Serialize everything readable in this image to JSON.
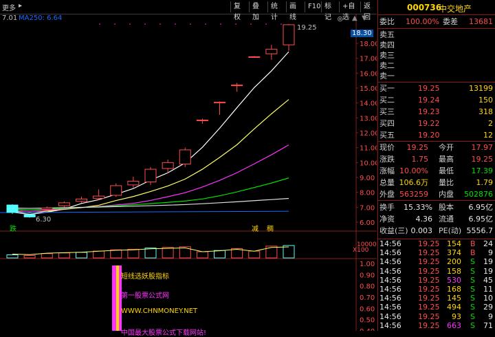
{
  "toolbar": {
    "more_label": "更多",
    "buttons": [
      "复权",
      "叠加",
      "统计",
      "画线",
      "F10",
      "标记",
      "+自选",
      "返回"
    ]
  },
  "chart_info": {
    "top_left_price": "7.01",
    "ma_label": "MA250: 6.64",
    "high_label": "19.25",
    "low_label": "6.30",
    "price_tag": "18.30",
    "marker_die": "跌",
    "marker_jian": "减",
    "marker_chou": "稠",
    "volume_unit": "X100",
    "volume_axis": "10000",
    "indicator_texts": [
      "短线选妖股指标",
      "第一股票公式网",
      "WWW.CHNMONEY.NET",
      "中国最大股票公式下载网站!"
    ]
  },
  "price_axis": [
    "18.00",
    "17.00",
    "16.00",
    "15.00",
    "14.00",
    "13.00",
    "12.00",
    "11.00",
    "10.00",
    "9.00",
    "8.00",
    "7.00",
    "6.00"
  ],
  "indicator_axis": [
    "1.00",
    "0.90",
    "0.80",
    "0.70",
    "0.60",
    "0.50",
    "0.40"
  ],
  "candles": [
    {
      "o": 7.15,
      "c": 6.65,
      "h": 7.2,
      "l": 6.55
    },
    {
      "o": 6.5,
      "c": 6.35,
      "h": 6.55,
      "l": 6.3
    },
    {
      "o": 6.85,
      "c": 6.95,
      "h": 7.05,
      "l": 6.8
    },
    {
      "o": 7.1,
      "c": 7.3,
      "h": 7.4,
      "l": 7.0
    },
    {
      "o": 7.4,
      "c": 7.55,
      "h": 7.7,
      "l": 7.3
    },
    {
      "o": 7.6,
      "c": 7.75,
      "h": 8.2,
      "l": 7.5
    },
    {
      "o": 7.8,
      "c": 8.45,
      "h": 8.6,
      "l": 7.7
    },
    {
      "o": 8.5,
      "c": 8.75,
      "h": 9.05,
      "l": 8.3
    },
    {
      "o": 8.7,
      "c": 9.55,
      "h": 9.7,
      "l": 8.5
    },
    {
      "o": 9.6,
      "c": 10.0,
      "h": 10.2,
      "l": 9.3
    },
    {
      "o": 9.9,
      "c": 10.85,
      "h": 11.0,
      "l": 9.7
    },
    {
      "o": 12.85,
      "c": 12.85,
      "h": 12.95,
      "l": 12.6
    },
    {
      "o": 14.0,
      "c": 14.05,
      "h": 14.1,
      "l": 13.2
    },
    {
      "o": 15.2,
      "c": 15.2,
      "h": 15.35,
      "l": 14.75
    },
    {
      "o": 17.1,
      "c": 17.1,
      "h": 17.15,
      "l": 17.05
    },
    {
      "o": 17.3,
      "c": 17.6,
      "h": 17.9,
      "l": 16.9
    },
    {
      "o": 17.9,
      "c": 19.25,
      "h": 19.3,
      "l": 17.5
    }
  ],
  "quote": {
    "code": "000736",
    "name": "中交地产",
    "weibi_label": "委比",
    "weibi": "100.00%",
    "weicha_label": "委差",
    "weicha": "13681",
    "asks": [
      {
        "label": "卖五",
        "price": "",
        "vol": ""
      },
      {
        "label": "卖四",
        "price": "",
        "vol": ""
      },
      {
        "label": "卖三",
        "price": "",
        "vol": ""
      },
      {
        "label": "卖二",
        "price": "",
        "vol": ""
      },
      {
        "label": "卖一",
        "price": "",
        "vol": ""
      }
    ],
    "bids": [
      {
        "label": "买一",
        "price": "19.25",
        "vol": "13199"
      },
      {
        "label": "买二",
        "price": "19.24",
        "vol": "150"
      },
      {
        "label": "买三",
        "price": "19.23",
        "vol": "318"
      },
      {
        "label": "买四",
        "price": "19.22",
        "vol": "2"
      },
      {
        "label": "买五",
        "price": "19.20",
        "vol": "12"
      }
    ],
    "stats": [
      [
        "现价",
        "19.25",
        "今开",
        "17.97"
      ],
      [
        "涨跌",
        "1.75",
        "最高",
        "19.25"
      ],
      [
        "涨幅",
        "10.00%",
        "最低",
        "17.39"
      ],
      [
        "总量",
        "106.6万",
        "量比",
        "1.79"
      ],
      [
        "外盘",
        "563259",
        "内盘",
        "502876"
      ]
    ],
    "stats2": [
      [
        "换手",
        "15.33%",
        "股本",
        "6.95亿"
      ],
      [
        "净资",
        "4.36",
        "流通",
        "6.95亿"
      ],
      [
        "收益(三)",
        "0.003",
        "PE(动)",
        "5556.7"
      ]
    ],
    "ticks": [
      {
        "t": "14:56",
        "p": "19.25",
        "v": "154",
        "f": "B",
        "n": "24"
      },
      {
        "t": "14:56",
        "p": "19.25",
        "v": "374",
        "f": "B",
        "n": "9"
      },
      {
        "t": "14:56",
        "p": "19.25",
        "v": "200",
        "f": "S",
        "n": "19"
      },
      {
        "t": "14:56",
        "p": "19.25",
        "v": "158",
        "f": "S",
        "n": "19"
      },
      {
        "t": "14:56",
        "p": "19.25",
        "v": "530",
        "f": "S",
        "n": "45"
      },
      {
        "t": "14:56",
        "p": "19.25",
        "v": "168",
        "f": "S",
        "n": "11"
      },
      {
        "t": "14:56",
        "p": "19.25",
        "v": "145",
        "f": "S",
        "n": "10"
      },
      {
        "t": "14:56",
        "p": "19.25",
        "v": "494",
        "f": "S",
        "n": "29"
      },
      {
        "t": "14:56",
        "p": "19.25",
        "v": "93",
        "f": "S",
        "n": "9"
      },
      {
        "t": "14:56",
        "p": "19.25",
        "v": "663",
        "f": "S",
        "n": "71"
      }
    ]
  }
}
